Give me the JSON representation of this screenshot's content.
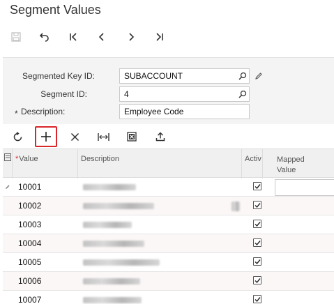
{
  "page": {
    "title": "Segment Values"
  },
  "toolbar": {
    "buttons": [
      {
        "name": "save-button",
        "icon": "save-icon"
      },
      {
        "name": "undo-button",
        "icon": "undo-icon"
      },
      {
        "name": "first-record-button",
        "icon": "first-icon"
      },
      {
        "name": "previous-record-button",
        "icon": "previous-icon"
      },
      {
        "name": "next-record-button",
        "icon": "next-icon"
      },
      {
        "name": "last-record-button",
        "icon": "last-icon"
      }
    ]
  },
  "form": {
    "segmented_key_label": "Segmented Key ID:",
    "segmented_key_value": "SUBACCOUNT",
    "segment_id_label": "Segment ID:",
    "segment_id_value": "4",
    "description_required": "*",
    "description_label": "Description:",
    "description_value": "Employee Code"
  },
  "grid_toolbar": {
    "buttons": [
      {
        "name": "refresh-button",
        "icon": "refresh-icon"
      },
      {
        "name": "add-row-button",
        "icon": "plus-icon",
        "highlighted": true
      },
      {
        "name": "delete-row-button",
        "icon": "close-icon"
      },
      {
        "name": "fit-columns-button",
        "icon": "fit-width-icon"
      },
      {
        "name": "export-excel-button",
        "icon": "excel-icon"
      },
      {
        "name": "upload-button",
        "icon": "upload-icon"
      }
    ]
  },
  "grid": {
    "columns": {
      "value_required": "*",
      "value": "Value",
      "description": "Description",
      "active": "Activ",
      "mapped_value_line1": "Mapped",
      "mapped_value_line2": "Value"
    },
    "rows": [
      {
        "value": "10001",
        "active": true,
        "editing": true
      },
      {
        "value": "10002",
        "active": true
      },
      {
        "value": "10003",
        "active": true
      },
      {
        "value": "10004",
        "active": true
      },
      {
        "value": "10005",
        "active": true
      },
      {
        "value": "10006",
        "active": true
      },
      {
        "value": "10007",
        "active": true
      }
    ]
  },
  "colors": {
    "highlight_border": "#d9262b",
    "panel_bg": "#f4f4f4",
    "header_bg": "#f0f0f0"
  }
}
